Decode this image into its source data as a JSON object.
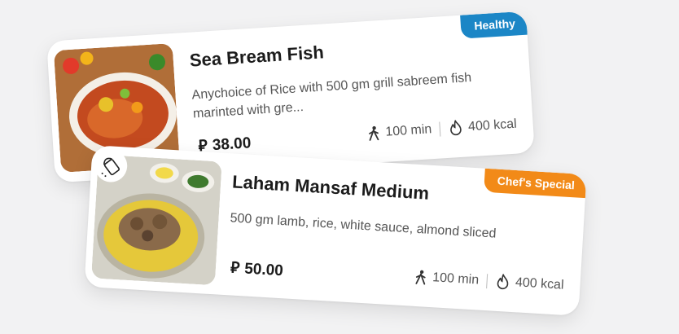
{
  "cards": [
    {
      "title": "Sea Bream Fish",
      "description": "Anychoice of Rice with 500 gm grill sabreem fish marinted with gre...",
      "currency_symbol": "⃁",
      "price": "38.00",
      "time": "100 min",
      "calories": "400 kcal",
      "badge": "Healthy",
      "badge_color": "#1b86c6"
    },
    {
      "title": "Laham Mansaf Medium",
      "description": "500 gm lamb, rice, white sauce, almond sliced",
      "currency_symbol": "⃁",
      "price": "50.00",
      "time": "100 min",
      "calories": "400 kcal",
      "badge": "Chef's Special",
      "badge_color": "#f28a18"
    }
  ],
  "icons": {
    "walk": "walking-person-icon",
    "calories": "flame-icon",
    "salt": "salt-shaker-icon"
  }
}
